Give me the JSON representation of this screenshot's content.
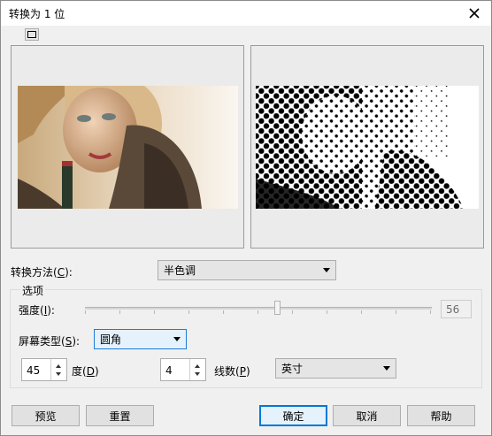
{
  "window": {
    "title": "转换为 1 位"
  },
  "toolbar": {
    "split_view_icon": "single-preview-icon"
  },
  "method": {
    "label_prefix": "转换方法(",
    "label_key": "C",
    "label_suffix": "):",
    "value": "半色调"
  },
  "options": {
    "group_label": "选项",
    "intensity": {
      "label_prefix": "强度(",
      "label_key": "I",
      "label_suffix": "):",
      "value": "56"
    },
    "screen_type": {
      "label_prefix": "屏幕类型(",
      "label_key": "S",
      "label_suffix": "):",
      "value": "圆角"
    },
    "angle": {
      "value": "45",
      "label_prefix": "度(",
      "label_key": "D",
      "label_suffix": ")"
    },
    "lines": {
      "value": "4",
      "label_prefix": "线数(",
      "label_key": "P",
      "label_suffix": ")"
    },
    "unit": {
      "value": "英寸"
    }
  },
  "buttons": {
    "preview": "预览",
    "reset": "重置",
    "ok": "确定",
    "cancel": "取消",
    "help": "帮助"
  }
}
